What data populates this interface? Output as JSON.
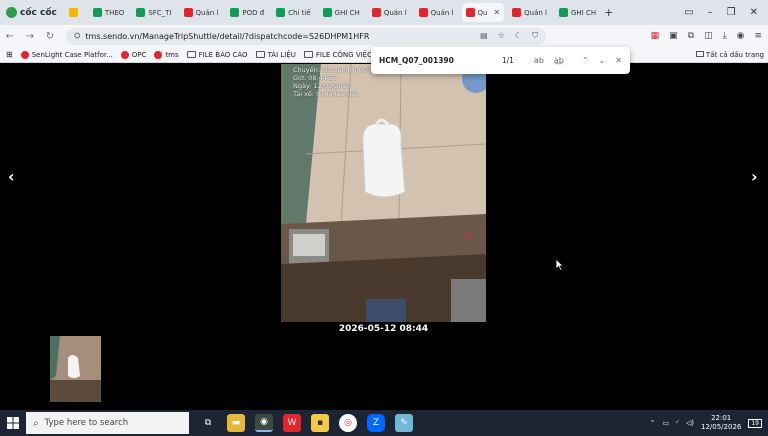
{
  "browser": {
    "brand": "cốc cốc",
    "tabs": [
      {
        "label": "",
        "icon": "drive-icon",
        "color": "#f4b400"
      },
      {
        "label": "THEO",
        "icon": "sheets-icon",
        "color": "#0f9d58"
      },
      {
        "label": "SFC_TI",
        "icon": "sheets-icon",
        "color": "#0f9d58"
      },
      {
        "label": "Quản l",
        "icon": "sendo-icon",
        "color": "#e4252d"
      },
      {
        "label": "POD đ",
        "icon": "pod-icon",
        "color": "#0f9d58"
      },
      {
        "label": "Chi tiế",
        "icon": "pod-icon",
        "color": "#0f9d58"
      },
      {
        "label": "GHI CH",
        "icon": "sheets-icon",
        "color": "#0f9d58"
      },
      {
        "label": "Quản l",
        "icon": "sendo-icon",
        "color": "#e4252d"
      },
      {
        "label": "Quản l",
        "icon": "sendo-icon",
        "color": "#e4252d"
      },
      {
        "label": "Qu",
        "icon": "sendo-icon",
        "color": "#e4252d",
        "active": true
      },
      {
        "label": "Quản l",
        "icon": "sendo-icon",
        "color": "#e4252d"
      },
      {
        "label": "GHI CH",
        "icon": "sheets-icon",
        "color": "#0f9d58"
      }
    ],
    "url": "tms.sendo.vn/ManageTripShuttle/detail/?dispatchcode=S26DHPM1HFR",
    "bookmarks": [
      {
        "label": "SenLight Case Platfor...",
        "type": "site",
        "color": "#e4252d"
      },
      {
        "label": "OPC",
        "type": "site",
        "color": "#e4252d"
      },
      {
        "label": "tms",
        "type": "site",
        "color": "#e4252d"
      },
      {
        "label": "FILE BÁO CÁO",
        "type": "folder"
      },
      {
        "label": "TÀI LIỆU",
        "type": "folder"
      },
      {
        "label": "FILE CÔNG VIỆC",
        "type": "folder"
      }
    ],
    "all_bookmarks": "Tất cả dấu trang"
  },
  "find": {
    "query": "HCM_Q07_001390",
    "count": "1/1"
  },
  "viewer": {
    "stamp": [
      "Chuyến: chuyen4HP607",
      "Giờ: 08:44:53",
      "Ngày: 12/05/2026",
      "Tài xế: 0783425685"
    ],
    "caption": "2026-05-12 08:44",
    "prev_arrow": "‹",
    "next_arrow": "›"
  },
  "taskbar": {
    "search_placeholder": "Type here to search",
    "time": "22:01",
    "date": "12/05/2026",
    "notification_count": "19"
  }
}
